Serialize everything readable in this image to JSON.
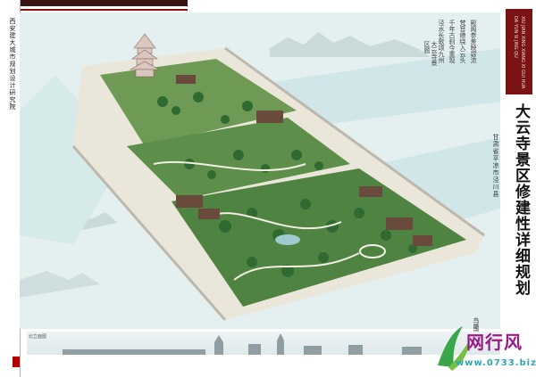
{
  "left_strip": {
    "vertical_text": "西安建大城市规划设计研究院"
  },
  "title_block": {
    "english_lines": [
      "DA YUN SI JING QU",
      "XIU JIAN XING XIANG XI GUI HUA"
    ],
    "main_title": "大云寺景区修建性详细规划",
    "subtitle": "甘肃省平凉市泾川县"
  },
  "poem": {
    "columns": [
      "殿阁参差映碧流",
      "梵音缭绕入云头",
      "千年古刹今重现",
      "泾水长歌颂九州",
      "大云寺景区题"
    ]
  },
  "skyline": {
    "label": "北立面图"
  },
  "side_label": "鸟瞰图",
  "watermark": {
    "title": "网行风",
    "url": "www.0733.biz"
  },
  "colors": {
    "accent_dark": "#3b1212",
    "accent_red": "#8a1010",
    "title_box": "#7a1414",
    "water": "#d9ecec",
    "greenery": "#3f7a3a",
    "roads": "#eae6da",
    "watermark_magenta": "#9b1a8a",
    "watermark_cyan": "#2ea8b0"
  }
}
